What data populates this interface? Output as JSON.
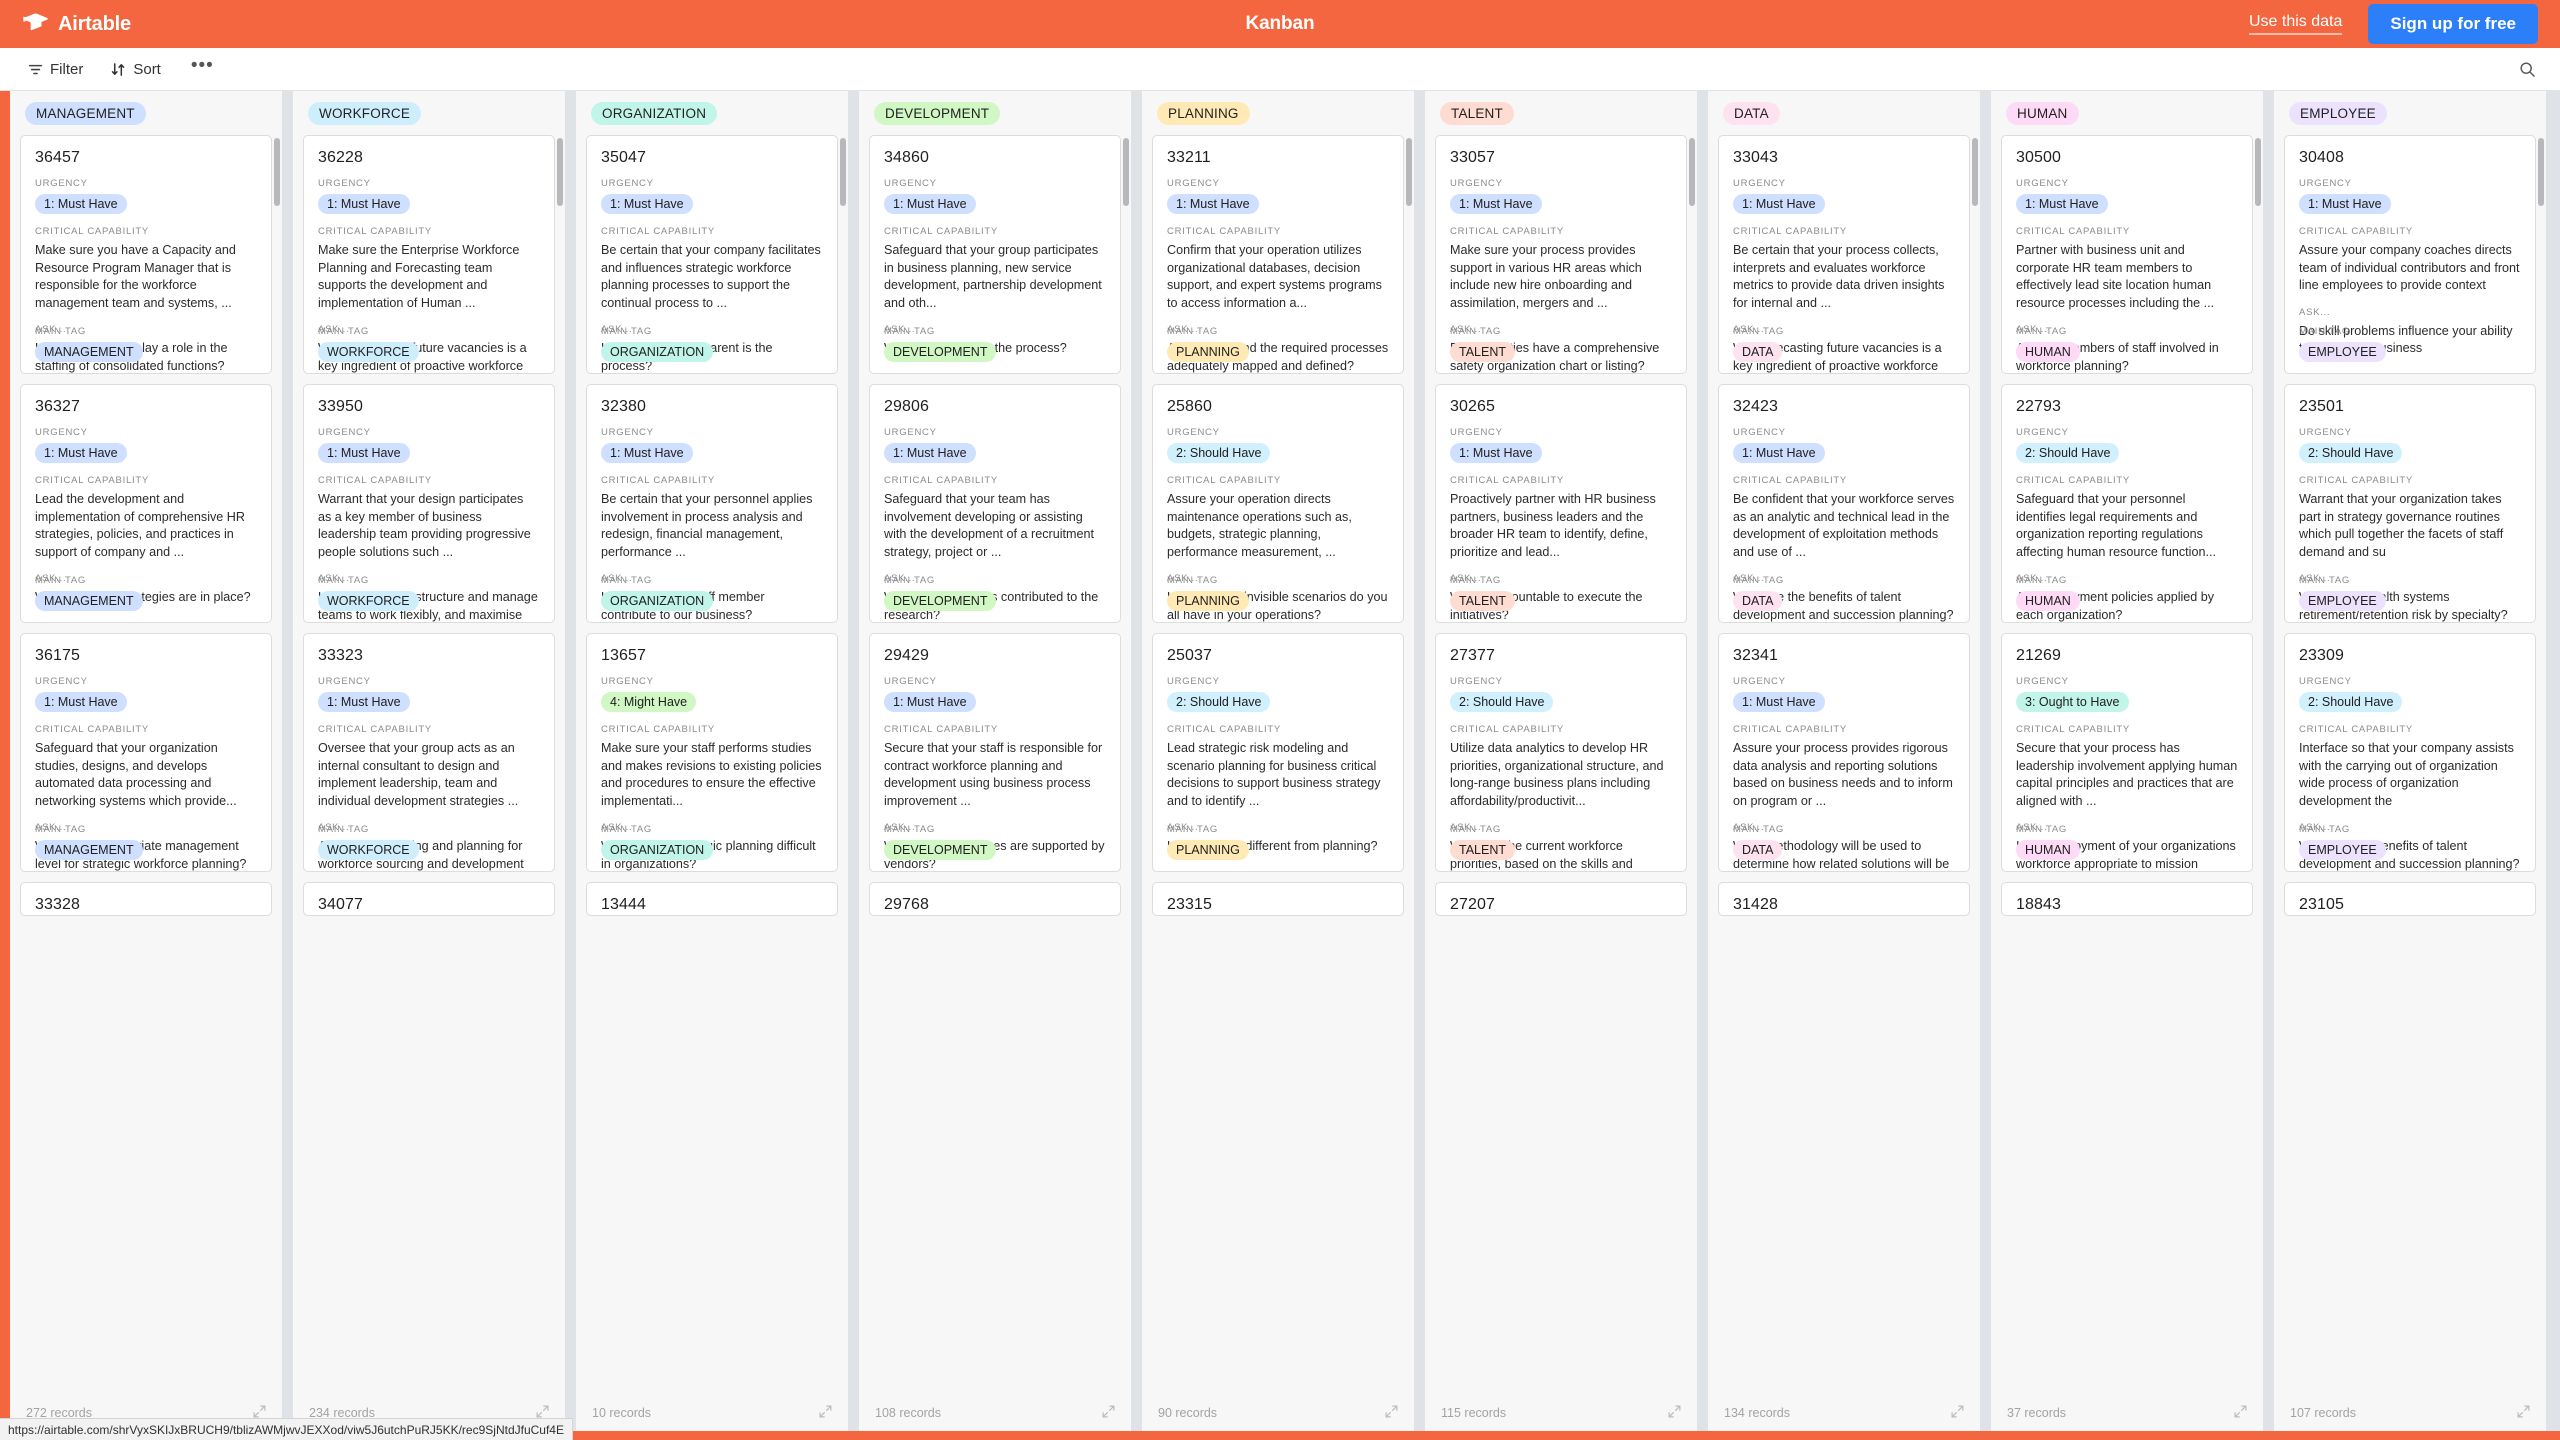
{
  "topbar": {
    "brand": "Airtable",
    "title": "Kanban",
    "use_this_data": "Use this data",
    "signup": "Sign up for free",
    "bg_color": "#f4663f",
    "signup_bg": "#2d7ff9"
  },
  "toolbar": {
    "filter": "Filter",
    "sort": "Sort",
    "more": "•••"
  },
  "statusbar": {
    "url": "https://airtable.com/shrVyxSKIJxBRUCH9/tblizAWMjwvJEXXod/viw5J6utchPuRJ5KK/rec9SjNtdJfuCuf4E"
  },
  "card_fields": {
    "urgency": "URGENCY",
    "critical_capability": "CRITICAL CAPABILITY",
    "ask": "ASK...",
    "main_tag": "MAIN TAG"
  },
  "urgency_colors": {
    "1: Must Have": "#cfdfff",
    "2: Should Have": "#d0f0fd",
    "3: Ought to Have": "#c2f5e9",
    "4: Might Have": "#d1f7c4"
  },
  "tag_colors": {
    "MANAGEMENT": "#cfdfff",
    "WORKFORCE": "#cfeefd",
    "ORGANIZATION": "#c2f5e9",
    "DEVELOPMENT": "#d1f7c4",
    "PLANNING": "#ffeab6",
    "TALENT": "#ffdcd1",
    "DATA": "#fee2f0",
    "HUMAN": "#ffdaf6",
    "EMPLOYEE": "#ede2fe"
  },
  "columns": [
    {
      "name": "MANAGEMENT",
      "records": "272 records",
      "cards": [
        {
          "id": "36457",
          "urgency": "1: Must Have",
          "capability": "Make sure you have a Capacity and Resource Program Manager that is responsible for the workforce management team and systems, ...",
          "ask": "How will seniority play a role in the staffing of consolidated functions?",
          "tag": "MANAGEMENT"
        },
        {
          "id": "36327",
          "urgency": "1: Must Have",
          "capability": "Lead the development and implementation of comprehensive HR strategies, policies, and practices in support of company and ...",
          "ask": "What retention strategies are in place?",
          "tag": "MANAGEMENT"
        },
        {
          "id": "36175",
          "urgency": "1: Must Have",
          "capability": "Safeguard that your organization studies, designs, and develops automated data processing and networking systems which provide...",
          "ask": "What is an appropriate management level for strategic workforce planning?",
          "tag": "MANAGEMENT"
        },
        {
          "id": "33328",
          "partial": true
        }
      ]
    },
    {
      "name": "WORKFORCE",
      "records": "234 records",
      "cards": [
        {
          "id": "36228",
          "urgency": "1: Must Have",
          "capability": "Make sure the Enterprise Workforce Planning and Forecasting team supports the development and implementation of Human ...",
          "ask": "Why forecasting future vacancies is a key ingredient of proactive workforce planning?",
          "tag": "WORKFORCE"
        },
        {
          "id": "33950",
          "urgency": "1: Must Have",
          "capability": "Warrant that your design participates as a key member of business leadership team providing progressive people solutions such ...",
          "ask": "How do you best structure and manage teams to work flexibly, and maximise competency and productivity?",
          "tag": "WORKFORCE"
        },
        {
          "id": "33323",
          "urgency": "1: Must Have",
          "capability": "Oversee that your group acts as an internal consultant to design and implement leadership, team and individual development strategies ...",
          "ask": "Are you anticipating and planning for workforce sourcing and development requirements in emerging markets?",
          "tag": "WORKFORCE"
        },
        {
          "id": "34077",
          "partial": true
        }
      ]
    },
    {
      "name": "ORGANIZATION",
      "records": "10 records",
      "cards": [
        {
          "id": "35047",
          "urgency": "1: Must Have",
          "capability": "Be certain that your company facilitates and influences strategic workforce planning processes to support the continual process to ...",
          "ask": "How fair and transparent is the process?",
          "tag": "ORGANIZATION"
        },
        {
          "id": "32380",
          "urgency": "1: Must Have",
          "capability": "Be certain that your personnel applies involvement in process analysis and redesign, financial management, performance ...",
          "ask": "How does each staff member contribute to our business?",
          "tag": "ORGANIZATION"
        },
        {
          "id": "13657",
          "urgency": "4: Might Have",
          "capability": "Make sure your staff performs studies and makes revisions to existing policies and procedures to ensure the effective implementati...",
          "ask": "What makes strategic planning difficult in organizations?",
          "tag": "ORGANIZATION"
        },
        {
          "id": "13444",
          "partial": true
        }
      ]
    },
    {
      "name": "DEVELOPMENT",
      "records": "108 records",
      "cards": [
        {
          "id": "34860",
          "urgency": "1: Must Have",
          "capability": "Safeguard that your group participates in business planning, new service development, partnership development and oth...",
          "ask": "Who participates in the process?",
          "tag": "DEVELOPMENT"
        },
        {
          "id": "29806",
          "urgency": "1: Must Have",
          "capability": "Safeguard that your team has involvement developing or assisting with the development of a recruitment strategy, project or ...",
          "ask": "Which organizations contributed to the research?",
          "tag": "DEVELOPMENT"
        },
        {
          "id": "29429",
          "urgency": "1: Must Have",
          "capability": "Secure that your staff is responsible for contract workforce planning and development using business process improvement ...",
          "ask": "What other processes are supported by vendors?",
          "tag": "DEVELOPMENT"
        },
        {
          "id": "29768",
          "partial": true
        }
      ]
    },
    {
      "name": "PLANNING",
      "records": "90 records",
      "cards": [
        {
          "id": "33211",
          "urgency": "1: Must Have",
          "capability": "Confirm that your operation utilizes organizational databases, decision support, and expert systems programs to access information a...",
          "ask": "Are policies and the required processes adequately mapped and defined?",
          "tag": "PLANNING"
        },
        {
          "id": "25860",
          "urgency": "2: Should Have",
          "capability": "Assure your operation directs maintenance operations such as, budgets, strategic planning, performance measurement, ...",
          "ask": "How many of invisible scenarios do you all have in your operations?",
          "tag": "PLANNING"
        },
        {
          "id": "25037",
          "urgency": "2: Should Have",
          "capability": "Lead strategic risk modeling and scenario planning for business critical decisions to support business strategy and to identify ...",
          "ask": "How is reality different from planning?",
          "tag": "PLANNING"
        },
        {
          "id": "23315",
          "partial": true
        }
      ]
    },
    {
      "name": "TALENT",
      "records": "115 records",
      "cards": [
        {
          "id": "33057",
          "urgency": "1: Must Have",
          "capability": "Make sure your process provides support in various HR areas which include new hire onboarding and assimilation, mergers and ...",
          "ask": "Do the utilities have a comprehensive safety organization chart or listing?",
          "tag": "TALENT"
        },
        {
          "id": "30265",
          "urgency": "1: Must Have",
          "capability": "Proactively partner with HR business partners, business leaders and the broader HR team to identify, define, prioritize and lead...",
          "ask": "Who is accountable to execute the initiatives?",
          "tag": "TALENT"
        },
        {
          "id": "27377",
          "urgency": "2: Should Have",
          "capability": "Utilize data analytics to develop HR priorities, organizational structure, and long-range business plans including affordability/productivit...",
          "ask": "What are the current workforce priorities, based on the skills and workforce profile analysis?",
          "tag": "TALENT"
        },
        {
          "id": "27207",
          "partial": true
        }
      ]
    },
    {
      "name": "DATA",
      "records": "134 records",
      "cards": [
        {
          "id": "33043",
          "urgency": "1: Must Have",
          "capability": "Be certain that your process collects, interprets and evaluates workforce metrics to provide data driven insights for internal and ...",
          "ask": "Why forecasting future vacancies is a key ingredient of proactive workforce planning?",
          "tag": "DATA"
        },
        {
          "id": "32423",
          "urgency": "1: Must Have",
          "capability": "Be confident that your workforce serves as an analytic and technical lead in the development of exploitation methods and use of ...",
          "ask": "What are the benefits of talent development and succession planning?",
          "tag": "DATA"
        },
        {
          "id": "32341",
          "urgency": "1: Must Have",
          "capability": "Assure your process provides rigorous data analysis and reporting solutions based on business needs and to inform on program or ...",
          "ask": "What methodology will be used to determine how related solutions will be integrated?",
          "tag": "DATA"
        },
        {
          "id": "31428",
          "partial": true
        }
      ]
    },
    {
      "name": "HUMAN",
      "records": "37 records",
      "cards": [
        {
          "id": "30500",
          "urgency": "1: Must Have",
          "capability": "Partner with business unit and corporate HR team members to effectively lead site location human resource processes including the ...",
          "ask": "Are key members of staff involved in workforce planning?",
          "tag": "HUMAN"
        },
        {
          "id": "22793",
          "urgency": "2: Should Have",
          "capability": "Safeguard that your personnel identifies legal requirements and organization reporting regulations affecting human resource function...",
          "ask": "Are employment policies applied by each organization?",
          "tag": "HUMAN"
        },
        {
          "id": "21269",
          "urgency": "3: Ought to Have",
          "capability": "Secure that your process has leadership involvement applying human capital principles and practices that are aligned with ...",
          "ask": "Is the deployment of your organizations workforce appropriate to mission accomplishment and keyed to ...",
          "tag": "HUMAN"
        },
        {
          "id": "18843",
          "partial": true
        }
      ]
    },
    {
      "name": "EMPLOYEE",
      "records": "107 records",
      "cards": [
        {
          "id": "30408",
          "urgency": "1: Must Have",
          "capability": "Assure your company coaches directs team of individual contributors and front line employees to provide context",
          "ask": "Do skill problems influence your ability to meet your business",
          "tag": "EMPLOYEE"
        },
        {
          "id": "23501",
          "urgency": "2: Should Have",
          "capability": "Warrant that your organization takes part in strategy governance routines which pull together the facets of staff demand and su",
          "ask": "What is the health systems retirement/retention risk by specialty?",
          "tag": "EMPLOYEE"
        },
        {
          "id": "23309",
          "urgency": "2: Should Have",
          "capability": "Interface so that your company assists with the carrying out of organization wide process of organization development the",
          "ask": "What are the benefits of talent development and succession planning?",
          "tag": "EMPLOYEE"
        },
        {
          "id": "23105",
          "partial": true
        }
      ]
    }
  ]
}
